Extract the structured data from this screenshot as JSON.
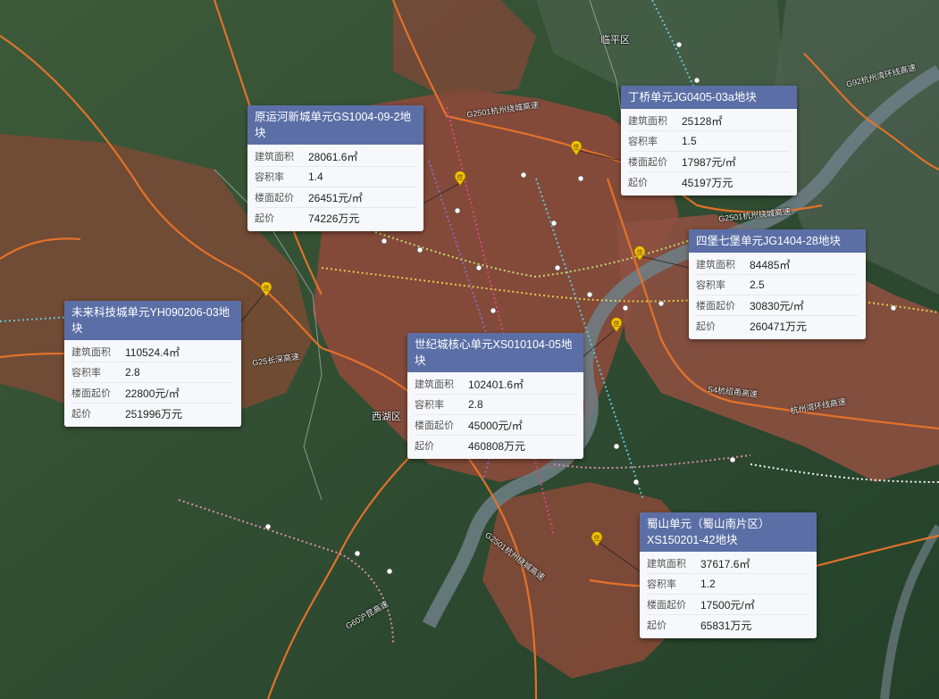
{
  "map_labels": {
    "district_linping": "临平区",
    "district_xihu": "西湖区"
  },
  "road_labels": [
    "G2501杭州绕城高速",
    "G2501杭州绕城高速",
    "G25长深高速",
    "S4杭绍甬高速",
    "杭州湾环线高速",
    "G92杭州湾环线高速",
    "G2501杭州绕城高速",
    "G60沪昆高速"
  ],
  "field_labels": {
    "area": "建筑面积",
    "far": "容积率",
    "floor_price": "楼面起价",
    "start_price": "起价"
  },
  "parcels": [
    {
      "title": "原运河新城单元GS1004-09-2地块",
      "area": "28061.6㎡",
      "far": "1.4",
      "floor_price": "26451元/㎡",
      "start_price": "74226万元"
    },
    {
      "title": "丁桥单元JG0405-03a地块",
      "area": "25128㎡",
      "far": "1.5",
      "floor_price": "17987元/㎡",
      "start_price": "45197万元"
    },
    {
      "title": "四堡七堡单元JG1404-28地块",
      "area": "84485㎡",
      "far": "2.5",
      "floor_price": "30830元/㎡",
      "start_price": "260471万元"
    },
    {
      "title": "未来科技城单元YH090206-03地块",
      "area": "110524.4㎡",
      "far": "2.8",
      "floor_price": "22800元/㎡",
      "start_price": "251996万元"
    },
    {
      "title": "世纪城核心单元XS010104-05地块",
      "area": "102401.6㎡",
      "far": "2.8",
      "floor_price": "45000元/㎡",
      "start_price": "460808万元"
    },
    {
      "title": "蜀山单元（蜀山南片区）XS150201-42地块",
      "area": "37617.6㎡",
      "far": "1.2",
      "floor_price": "17500元/㎡",
      "start_price": "65831万元"
    }
  ],
  "colors": {
    "card_header": "#5b6fa6",
    "urban_area": "#8a4a3a",
    "pin": "#f2c200"
  }
}
